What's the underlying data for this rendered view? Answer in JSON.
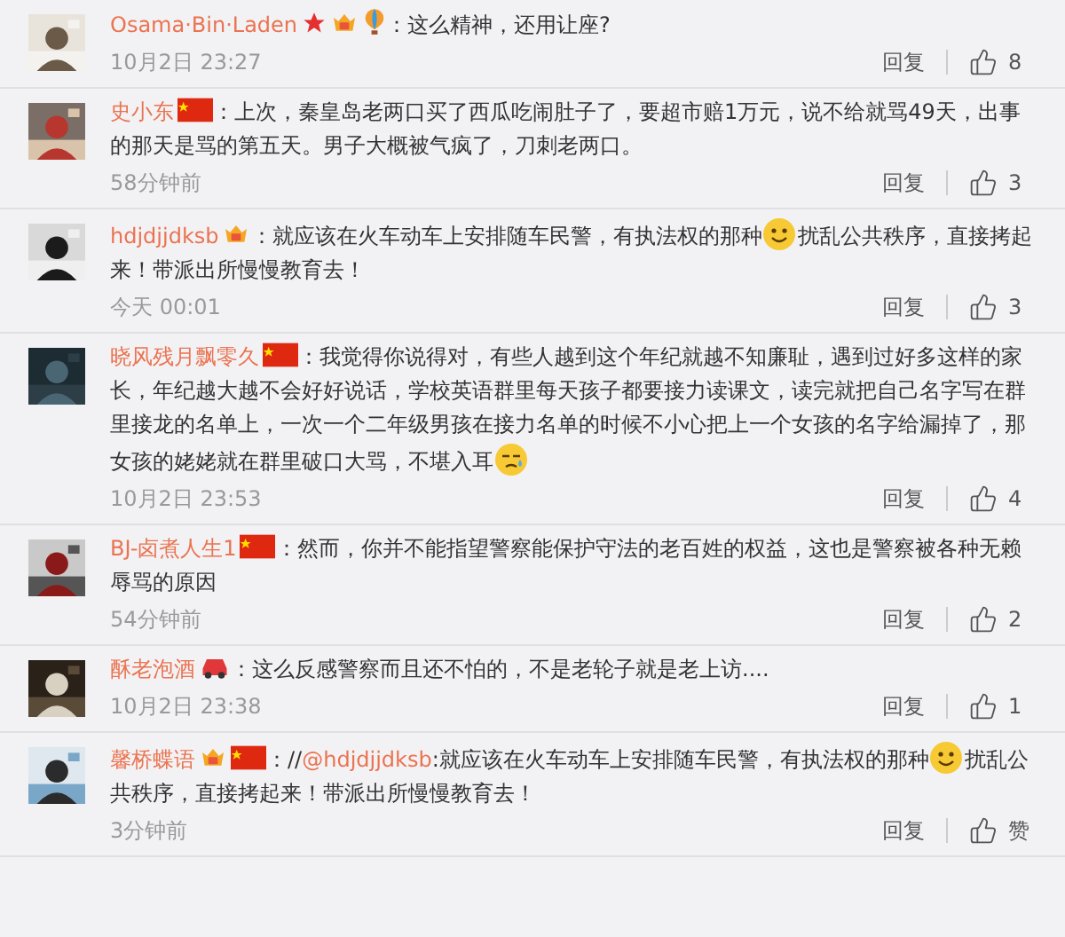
{
  "comments": [
    {
      "user": "Osama·Bin·Laden",
      "badges": [
        {
          "kind": "star"
        },
        {
          "kind": "vip"
        },
        {
          "kind": "balloon"
        }
      ],
      "body": [
        {
          "kind": "text",
          "text": "：这么精神，还用让座?"
        }
      ],
      "time": "10月2日 23:27",
      "reply": "回复",
      "likes": "8"
    },
    {
      "user": "史小东",
      "badges": [
        {
          "kind": "flag"
        }
      ],
      "body": [
        {
          "kind": "text",
          "text": "：上次，秦皇岛老两口买了西瓜吃闹肚子了，要超市赔1万元，说不给就骂49天，出事的那天是骂的第五天。男子大概被气疯了，刀刺老两口。"
        }
      ],
      "time": "58分钟前",
      "reply": "回复",
      "likes": "3"
    },
    {
      "user": "hdjdjjdksb",
      "badges": [
        {
          "kind": "vip"
        }
      ],
      "body": [
        {
          "kind": "text",
          "text": "：就应该在火车动车上安排随车民警，有执法权的那种"
        },
        {
          "kind": "smile"
        },
        {
          "kind": "text",
          "text": "扰乱公共秩序，直接拷起来！带派出所慢慢教育去！"
        }
      ],
      "time": "今天 00:01",
      "reply": "回复",
      "likes": "3"
    },
    {
      "user": "晓风残月飘零久",
      "badges": [
        {
          "kind": "flag"
        }
      ],
      "body": [
        {
          "kind": "text",
          "text": "：我觉得你说得对，有些人越到这个年纪就越不知廉耻，遇到过好多这样的家长，年纪越大越不会好好说话，学校英语群里每天孩子都要接力读课文，读完就把自己名字写在群里接龙的名单上，一次一个二年级男孩在接力名单的时候不小心把上一个女孩的名字给漏掉了，那女孩的姥姥就在群里破口大骂，不堪入耳"
        },
        {
          "kind": "sweat"
        }
      ],
      "time": "10月2日 23:53",
      "reply": "回复",
      "likes": "4"
    },
    {
      "user": "BJ-卤煮人生1",
      "badges": [
        {
          "kind": "flag"
        }
      ],
      "body": [
        {
          "kind": "text",
          "text": "：然而，你并不能指望警察能保护守法的老百姓的权益，这也是警察被各种无赖辱骂的原因"
        }
      ],
      "time": "54分钟前",
      "reply": "回复",
      "likes": "2"
    },
    {
      "user": "酥老泡酒",
      "badges": [
        {
          "kind": "car"
        }
      ],
      "body": [
        {
          "kind": "text",
          "text": "：这么反感警察而且还不怕的，不是老轮子就是老上访...."
        }
      ],
      "time": "10月2日 23:38",
      "reply": "回复",
      "likes": "1"
    },
    {
      "user": "馨桥蝶语",
      "badges": [
        {
          "kind": "vip"
        },
        {
          "kind": "flag"
        }
      ],
      "body": [
        {
          "kind": "text",
          "text": "：//"
        },
        {
          "kind": "mention",
          "text": "@hdjdjjdksb"
        },
        {
          "kind": "text",
          "text": ":就应该在火车动车上安排随车民警，有执法权的那种"
        },
        {
          "kind": "smile"
        },
        {
          "kind": "text",
          "text": "扰乱公共秩序，直接拷起来！带派出所慢慢教育去！"
        }
      ],
      "time": "3分钟前",
      "reply": "回复",
      "likes": "赞"
    }
  ]
}
